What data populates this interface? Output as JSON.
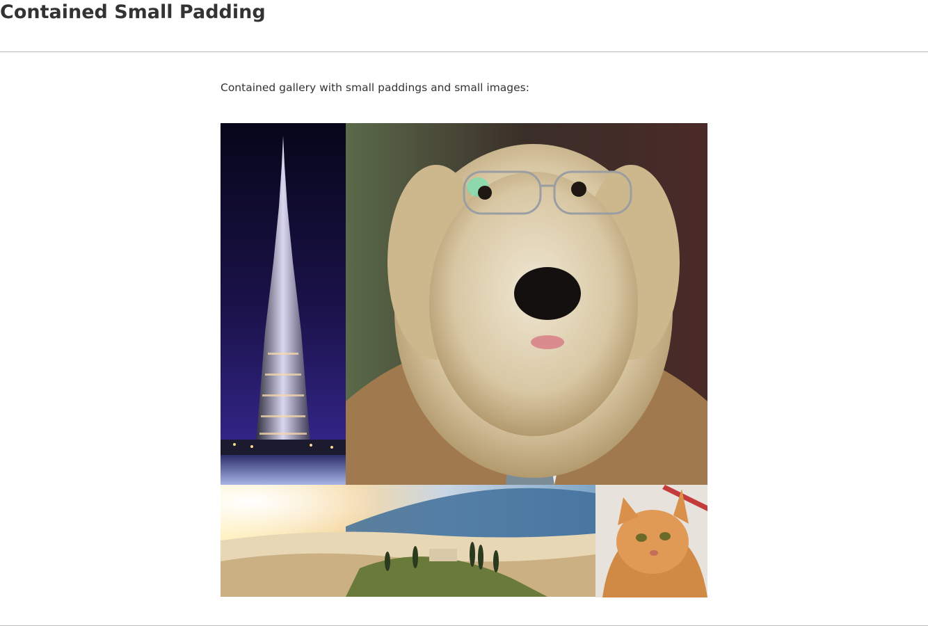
{
  "page": {
    "title": "Contained Small Padding",
    "intro": "Contained gallery with small paddings and small images:"
  },
  "gallery": {
    "images": [
      {
        "subject": "skyscraper-at-night"
      },
      {
        "subject": "dog-in-suit-with-glasses"
      },
      {
        "subject": "misty-hills-landscape"
      },
      {
        "subject": "orange-tabby-cat"
      }
    ]
  },
  "colors": {
    "text": "#333333",
    "rule": "#bdbdbd",
    "background": "#ffffff"
  }
}
